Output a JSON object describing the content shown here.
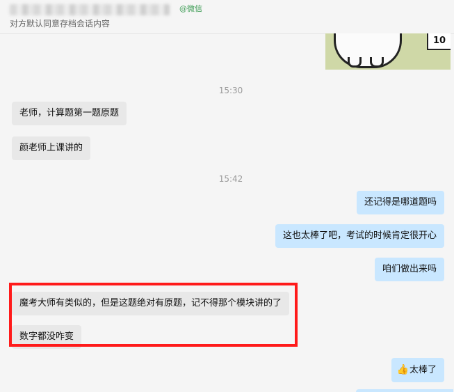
{
  "header": {
    "contact_name_blurred": true,
    "source_tag": "@微信",
    "consent_notice": "对方默认同意存档会话内容"
  },
  "sticker": {
    "sign_text": "10",
    "icon": "bear-sticker-icon"
  },
  "chat": {
    "timestamps": [
      "15:30",
      "15:42"
    ],
    "messages": [
      {
        "side": "in",
        "text": "老师，计算题第一题原题"
      },
      {
        "side": "in",
        "text": "颜老师上课讲的"
      },
      {
        "side": "out",
        "text": "还记得是哪道题吗"
      },
      {
        "side": "out",
        "text": "这也太棒了吧，考试的时候肯定很开心"
      },
      {
        "side": "out",
        "text": "咱们做出来吗"
      },
      {
        "side": "in",
        "text": "魔考大师有类似的，但是这题绝对有原题，记不得那个模块讲的了"
      },
      {
        "side": "in",
        "text": "数字都没咋变"
      },
      {
        "side": "out",
        "text": "太棒了",
        "emoji": "👍",
        "icon": "thumbs-up-icon"
      }
    ]
  },
  "annotation": {
    "color": "#ff1a1a"
  },
  "colors": {
    "incoming_bubble": "#e8e8e8",
    "outgoing_bubble": "#c9e7ff",
    "background": "#f5f5f5",
    "tag_green": "#3a9b52"
  }
}
